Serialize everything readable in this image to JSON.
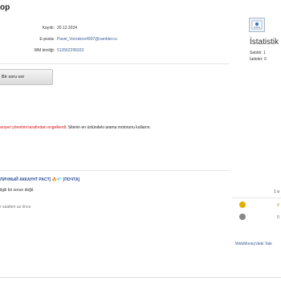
{
  "header": {
    "title": "op"
  },
  "profile": {
    "registered_label": "Kayıtlı:",
    "registered_value": "20.12.2024",
    "email_label": "E-posta:",
    "email_value": "Pavel_Voronkov4907@rambler.ru",
    "wmid_label": "WM kimliği:",
    "wmid_value": "513562295933"
  },
  "ask_button": {
    "label": "Bir soru sor"
  },
  "notice": {
    "red_text": "arıyeri yönetimi tarafından engellendi",
    "black_text": ". Sitenin en üstündeki arama motorunu kullanın."
  },
  "question": {
    "title": "ЛИЧНЫЙ АККАУНТ PACT]",
    "emoji": "🔥💎",
    "mail_tag": "[ПОЧТА]",
    "text": "ilgili bir sorun değil.",
    "time": "r saatten az önce",
    "count_right": "1 a"
  },
  "stats": {
    "title": "İstatistik",
    "sold_label": "Satıldı:",
    "sold_value": "1",
    "refunds_label": "İadeler:",
    "refunds_value": "0"
  },
  "feedback": {
    "positive_count": "0",
    "negative_count": "0",
    "positive_color": "#e0b000",
    "negative_color": "#888888"
  },
  "wm_link": {
    "label": "WebMoney'deki Tale"
  }
}
